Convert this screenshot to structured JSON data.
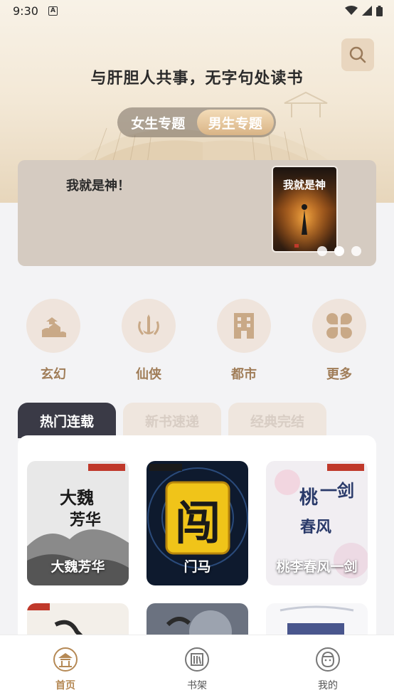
{
  "status_bar": {
    "time": "9:30",
    "notification_icon": "a-badge-icon"
  },
  "header": {
    "slogan": "与肝胆人共事，无字句处读书",
    "gender_tabs": [
      {
        "label": "女生专题",
        "active": false
      },
      {
        "label": "男生专题",
        "active": true
      }
    ]
  },
  "banner": {
    "title": "我就是神！",
    "cover_text": "我就是神",
    "active_dot": 1,
    "dot_count": 3
  },
  "categories": [
    {
      "label": "玄幻",
      "icon": "mountain-icon"
    },
    {
      "label": "仙侠",
      "icon": "sword-icon"
    },
    {
      "label": "都市",
      "icon": "building-icon"
    },
    {
      "label": "更多",
      "icon": "grid-icon"
    }
  ],
  "section_tabs": [
    {
      "label": "热门连载",
      "active": true
    },
    {
      "label": "新书速递",
      "active": false
    },
    {
      "label": "经典完结",
      "active": false
    }
  ],
  "books": [
    {
      "title": "大魏芳华",
      "cover_text": "大魏芳华"
    },
    {
      "title": "门马",
      "cover_text": "闯"
    },
    {
      "title": "桃李春风一剑",
      "cover_text": "桃李春风一剑"
    }
  ],
  "bottom_nav": [
    {
      "label": "首页",
      "icon": "home-pavilion-icon",
      "active": true
    },
    {
      "label": "书架",
      "icon": "bookshelf-icon",
      "active": false
    },
    {
      "label": "我的",
      "icon": "profile-icon",
      "active": false
    }
  ],
  "colors": {
    "accent": "#b58955",
    "active_tab_bg": "#3a3a46",
    "category_label": "#a07d58"
  }
}
